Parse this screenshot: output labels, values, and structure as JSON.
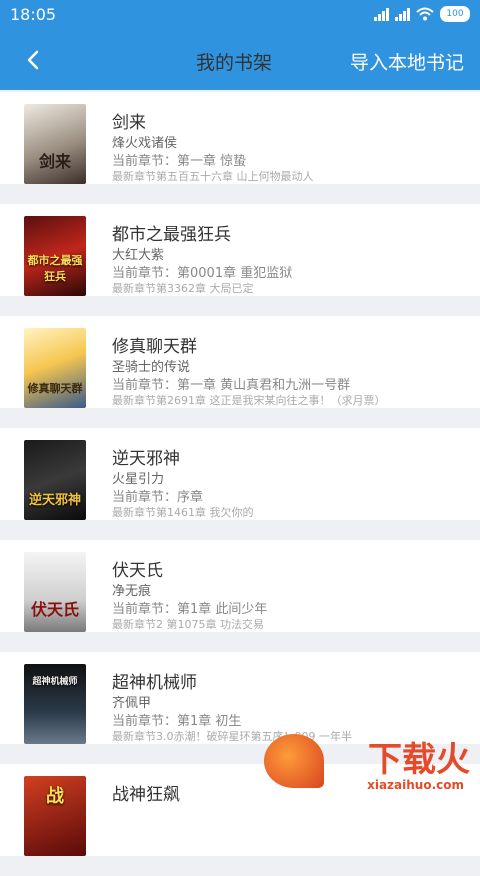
{
  "status_bar": {
    "time": "18:05",
    "battery": "100"
  },
  "navbar": {
    "title": "我的书架",
    "import": "导入本地书记"
  },
  "books": [
    {
      "title": "剑来",
      "author": "烽火戏诸侯",
      "current": "当前章节：第一章 惊蛰",
      "latest": "最新章节第五百五十六章 山上何物最动人",
      "cover_text": "剑来"
    },
    {
      "title": "都市之最强狂兵",
      "author": "大红大紫",
      "current": "当前章节：第0001章 重犯监狱",
      "latest": "最新章节第3362章 大局已定",
      "cover_text": "都市之最强狂兵"
    },
    {
      "title": "修真聊天群",
      "author": "圣骑士的传说",
      "current": "当前章节：第一章 黄山真君和九洲一号群",
      "latest": "最新章节第2691章 这正是我宋某向往之事！（求月票）",
      "cover_text": "修真聊天群"
    },
    {
      "title": "逆天邪神",
      "author": "火星引力",
      "current": "当前章节：序章",
      "latest": "最新章节第1461章 我欠你的",
      "cover_text": "逆天邪神"
    },
    {
      "title": "伏天氏",
      "author": "净无痕",
      "current": "当前章节：第1章  此间少年",
      "latest": "最新章节2 第1075章 功法交易",
      "cover_text": "伏天氏"
    },
    {
      "title": "超神机械师",
      "author": "齐佩甲",
      "current": "当前章节：第1章  初生",
      "latest": "最新章节3.0赤潮！破碎星环第五序！909 一年半",
      "cover_text": "超神机械师"
    },
    {
      "title": "战神狂飙",
      "author": "",
      "current": "",
      "latest": "",
      "cover_text": "战"
    }
  ],
  "watermark": {
    "text": "下载火",
    "url": "xiazaihuo.com"
  },
  "colors": {
    "primary": "#2f93e0",
    "background": "#eef0f3"
  }
}
